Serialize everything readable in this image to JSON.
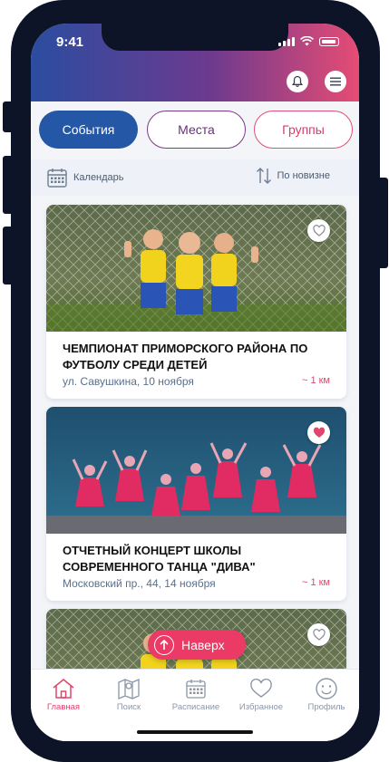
{
  "status": {
    "time": "9:41"
  },
  "segments": {
    "events": "События",
    "places": "Места",
    "groups": "Группы",
    "active": "events"
  },
  "toolbar": {
    "calendar_label": "Календарь",
    "sort_label": "По новизне"
  },
  "cards": [
    {
      "title": "ЧЕМПИОНАТ ПРИМОРСКОГО РАЙОНА ПО ФУТБОЛУ СРЕДИ ДЕТЕЙ",
      "meta": "ул. Савушкина, 10 ноября",
      "distance": "~ 1 км",
      "favorite": false,
      "image": "kids-football-team"
    },
    {
      "title": "ОТЧЕТНЫЙ КОНЦЕРТ ШКОЛЫ СОВРЕМЕННОГО ТАНЦА \"ДИВА\"",
      "meta": "Московский пр., 44, 14 ноября",
      "distance": "~ 1 км",
      "favorite": true,
      "image": "dance-concert"
    },
    {
      "favorite": false,
      "image": "kids-football-team"
    }
  ],
  "goto_top": {
    "label": "Наверх"
  },
  "tabbar": {
    "home": "Главная",
    "search": "Поиск",
    "schedule": "Расписание",
    "favorites": "Избранное",
    "profile": "Профиль",
    "active": "home"
  },
  "colors": {
    "primary": "#2457a6",
    "accent": "#e0456e",
    "purple": "#6a2f78"
  }
}
